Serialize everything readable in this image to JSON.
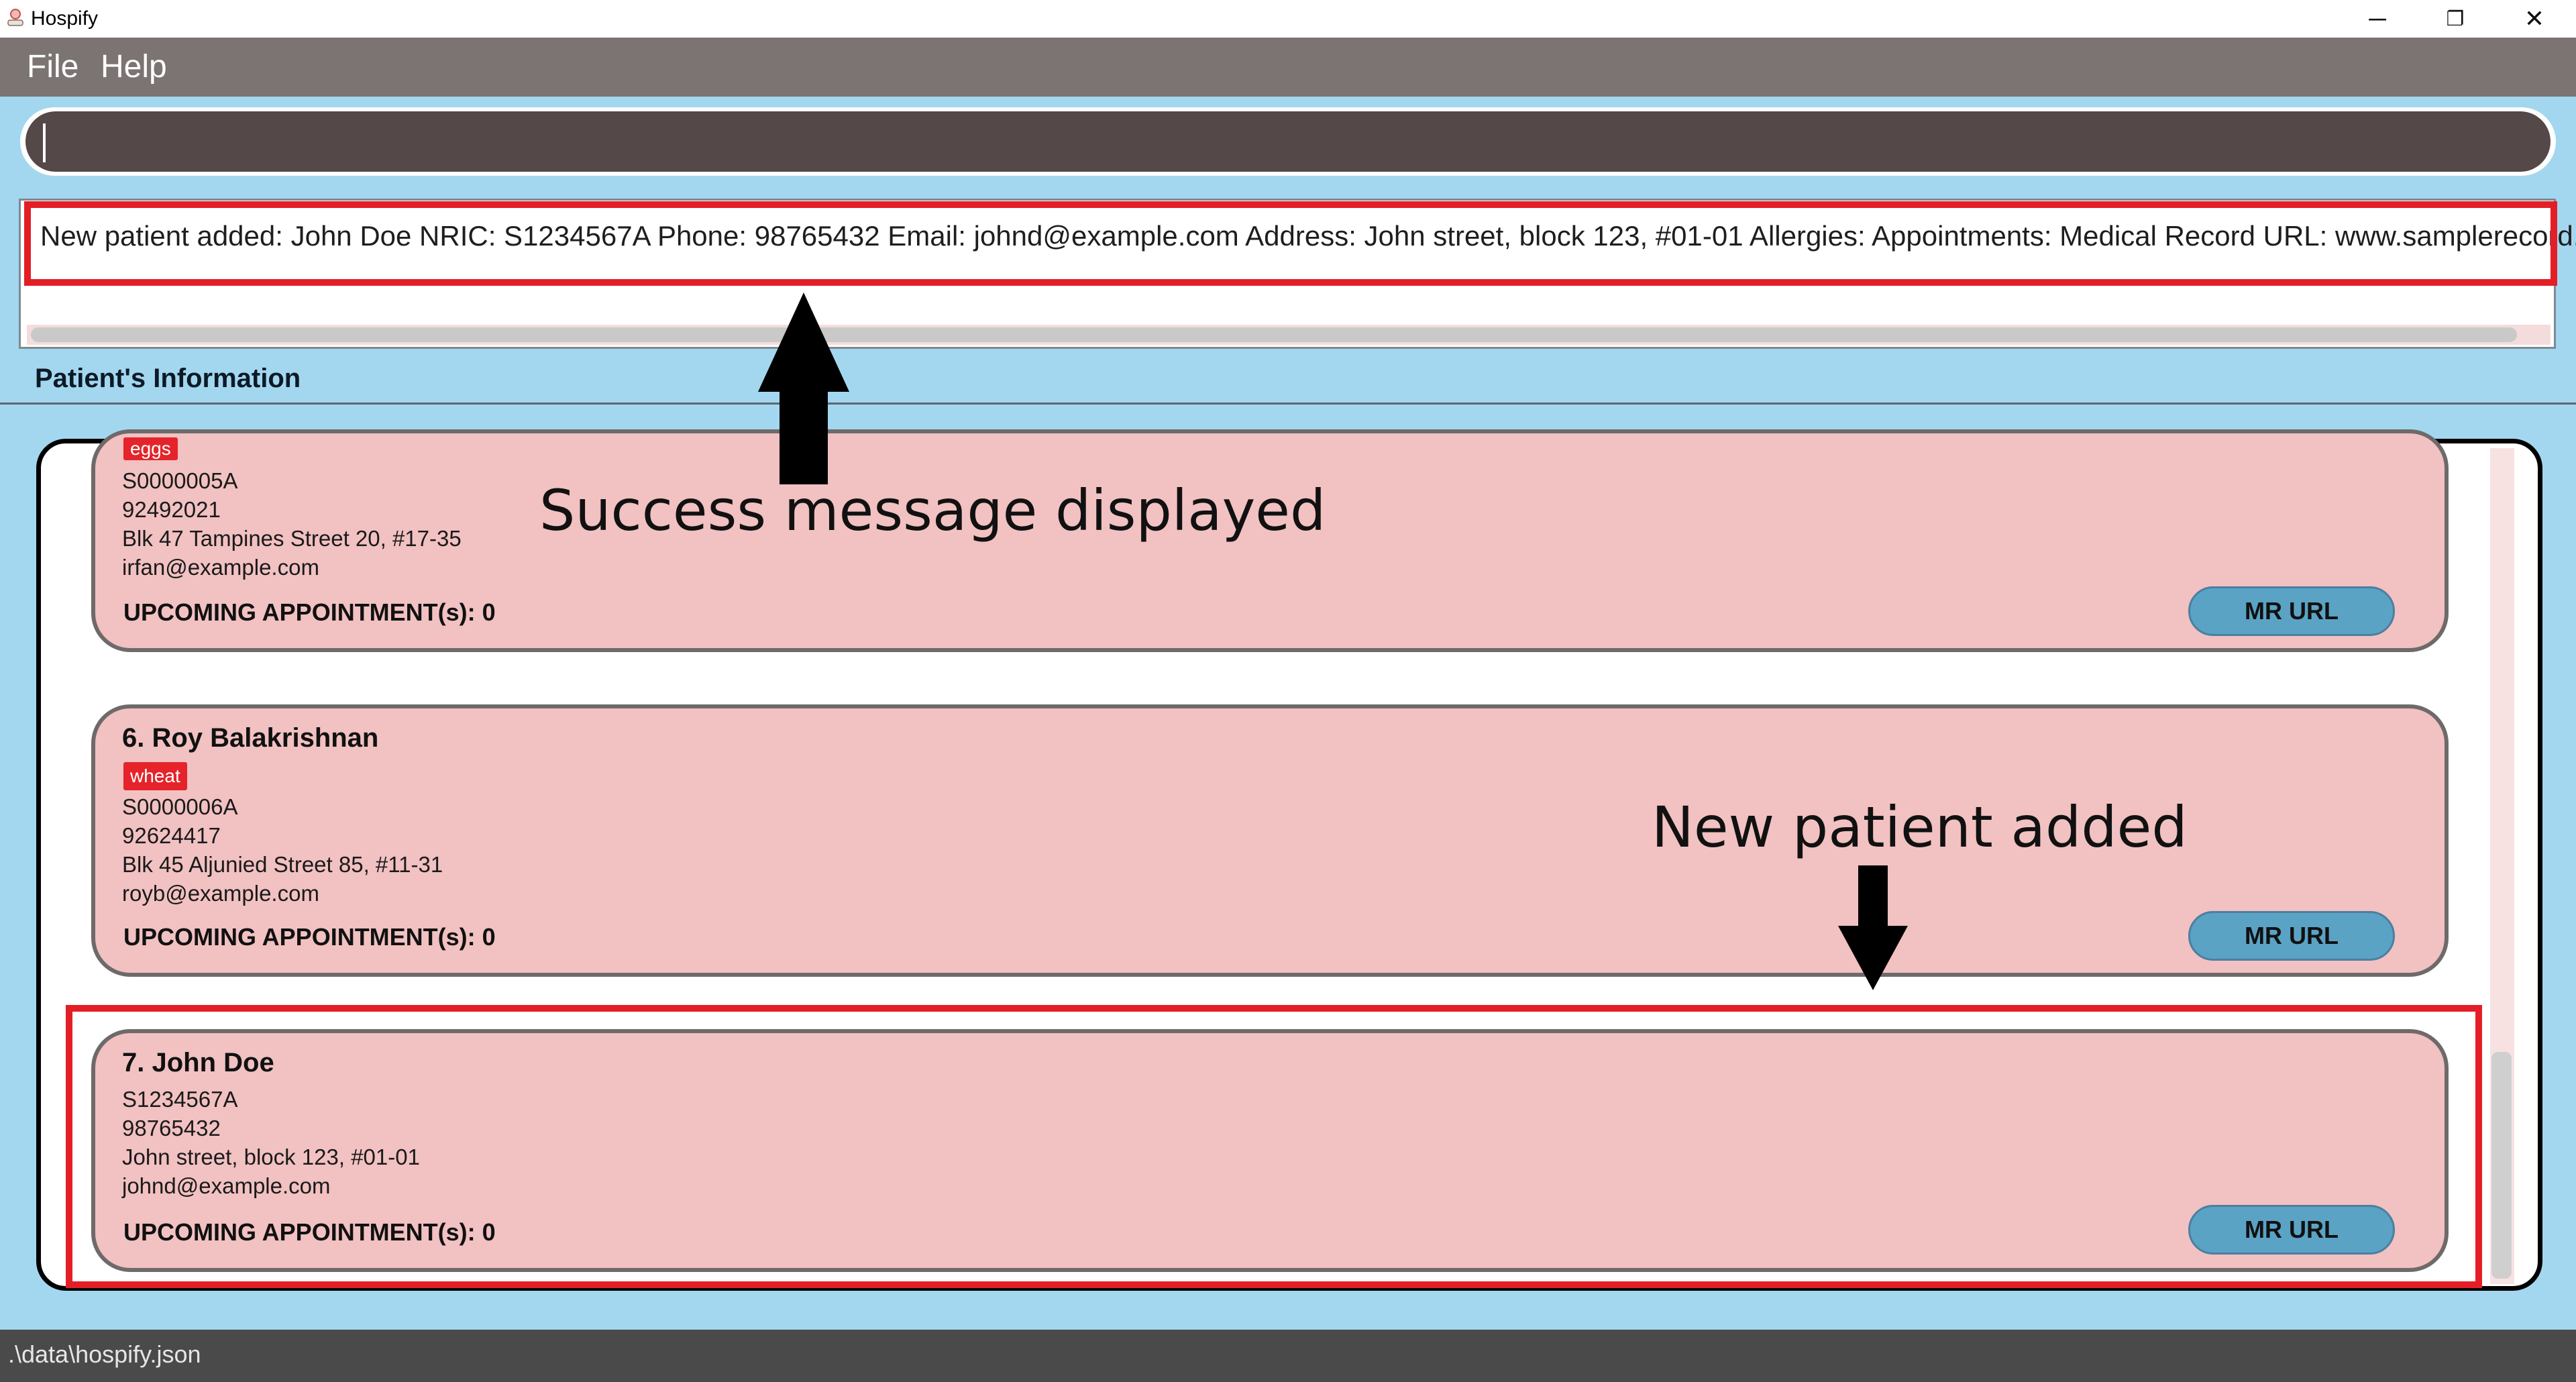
{
  "window": {
    "title": "Hospify",
    "controls": {
      "minimize": "─",
      "restore": "❐",
      "close": "✕"
    }
  },
  "menu": {
    "file": "File",
    "help": "Help"
  },
  "command_box": {
    "value": ""
  },
  "result": {
    "message": "New patient added: John Doe NRIC: S1234567A Phone: 98765432 Email: johnd@example.com Address: John street, block 123, #01-01 Allergies:  Appointments:  Medical Record URL: www.samplerecord.com/"
  },
  "panel": {
    "header": "Patient's Information"
  },
  "patients": [
    {
      "tag": "eggs",
      "nric": "S0000005A",
      "phone": "92492021",
      "address": "Blk 47 Tampines Street 20, #17-35",
      "email": "irfan@example.com",
      "appointments": "UPCOMING APPOINTMENT(s): 0",
      "mr_label": "MR URL"
    },
    {
      "name": "6.  Roy Balakrishnan",
      "tag": "wheat",
      "nric": "S0000006A",
      "phone": "92624417",
      "address": "Blk 45 Aljunied Street 85, #11-31",
      "email": "royb@example.com",
      "appointments": "UPCOMING APPOINTMENT(s): 0",
      "mr_label": "MR URL"
    },
    {
      "name": "7.  John Doe",
      "nric": "S1234567A",
      "phone": "98765432",
      "address": "John street, block 123, #01-01",
      "email": "johnd@example.com",
      "appointments": "UPCOMING APPOINTMENT(s): 0",
      "mr_label": "MR URL"
    }
  ],
  "annotations": {
    "success": "Success message displayed",
    "new_patient": "New patient added"
  },
  "status": {
    "path": ".\\data\\hospify.json"
  },
  "colors": {
    "accent_red": "#e41e26",
    "card_bg": "#f2c1c2",
    "button_blue": "#5aa3c5",
    "window_bg": "#a3d7f0"
  }
}
